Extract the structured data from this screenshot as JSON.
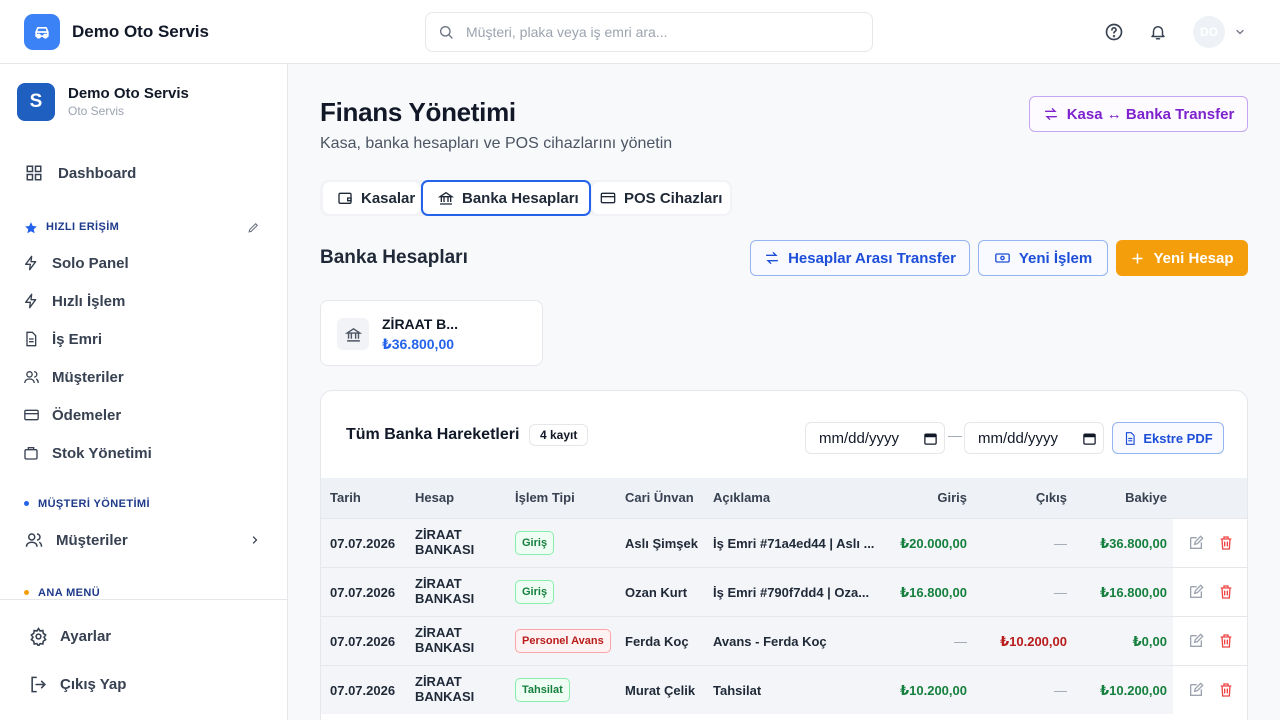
{
  "topbar": {
    "brand_name": "Demo Oto Servis",
    "search_placeholder": "Müşteri, plaka veya iş emri ara...",
    "avatar_initials": "DO"
  },
  "sidebar": {
    "org_initial": "S",
    "org_name": "Demo Oto Servis",
    "org_sub": "Oto Servis",
    "dashboard": "Dashboard",
    "quick_access_title": "HIZLI ERİŞİM",
    "quick_items": [
      "Solo Panel",
      "Hızlı İşlem",
      "İş Emri",
      "Müşteriler",
      "Ödemeler",
      "Stok Yönetimi"
    ],
    "customer_mgmt_title": "MÜŞTERİ YÖNETİMİ",
    "customers_group": "Müşteriler",
    "main_menu_title": "ANA MENÜ",
    "settings": "Ayarlar",
    "logout": "Çıkış Yap"
  },
  "page": {
    "title": "Finans Yönetimi",
    "subtitle": "Kasa, banka hesapları ve POS cihazlarını yönetin",
    "transfer_button": "Kasa ↔ Banka Transfer"
  },
  "tabs": [
    {
      "label": "Kasalar"
    },
    {
      "label": "Banka Hesapları"
    },
    {
      "label": "POS Cihazları"
    }
  ],
  "bank_section": {
    "title": "Banka Hesapları",
    "inter_transfer": "Hesaplar Arası Transfer",
    "new_transaction": "Yeni İşlem",
    "new_account": "Yeni Hesap"
  },
  "account_card": {
    "name": "ZİRAAT B...",
    "balance": "₺36.800,00"
  },
  "transactions": {
    "title": "Tüm Banka Hareketleri",
    "count": "4 kayıt",
    "date_from": "mm/dd/yyyy",
    "date_to": "mm/dd/yyyy",
    "date_separator": "—",
    "pdf_button": "Ekstre PDF",
    "headers": [
      "Tarih",
      "Hesap",
      "İşlem Tipi",
      "Cari Ünvan",
      "Açıklama",
      "Giriş",
      "Çıkış",
      "Bakiye"
    ],
    "rows": [
      {
        "date": "07.07.2026",
        "bank_l1": "ZİRAAT",
        "bank_l2": "BANKASI",
        "type": "Giriş",
        "party": "Aslı Şimşek",
        "desc": "İş Emri #71a4ed44 | Aslı ...",
        "in": "₺20.000,00",
        "out": "—",
        "balance": "₺36.800,00"
      },
      {
        "date": "07.07.2026",
        "bank_l1": "ZİRAAT",
        "bank_l2": "BANKASI",
        "type": "Giriş",
        "party": "Ozan Kurt",
        "desc": "İş Emri #790f7dd4 | Oza...",
        "in": "₺16.800,00",
        "out": "—",
        "balance": "₺16.800,00"
      },
      {
        "date": "07.07.2026",
        "bank_l1": "ZİRAAT",
        "bank_l2": "BANKASI",
        "type": "Personel Avans",
        "party": "Ferda Koç",
        "desc": "Avans - Ferda Koç",
        "in": "—",
        "out": "₺10.200,00",
        "balance": "₺0,00"
      },
      {
        "date": "07.07.2026",
        "bank_l1": "ZİRAAT",
        "bank_l2": "BANKASI",
        "type": "Tahsilat",
        "party": "Murat Çelik",
        "desc": "Tahsilat",
        "in": "₺10.200,00",
        "out": "—",
        "balance": "₺10.200,00"
      }
    ]
  },
  "colors": {
    "brand_blue": "#3b82f6",
    "org_blue": "#1f5fbf",
    "accent_orange": "#f59e0b",
    "accent_purple": "#7e22ce",
    "positive": "#15803d",
    "negative": "#b91c1c"
  },
  "icons": [
    "car-icon",
    "search-icon",
    "help-icon",
    "bell-icon",
    "chevron-down-icon",
    "dashboard-icon",
    "star-icon",
    "pencil-icon",
    "bolt-icon",
    "file-icon",
    "users-icon",
    "card-icon",
    "box-icon",
    "chevron-right-icon",
    "gear-icon",
    "logout-icon",
    "swap-icon",
    "wallet-icon",
    "bank-icon",
    "cash-icon",
    "plus-icon",
    "calendar-icon",
    "edit-icon",
    "trash-icon"
  ]
}
